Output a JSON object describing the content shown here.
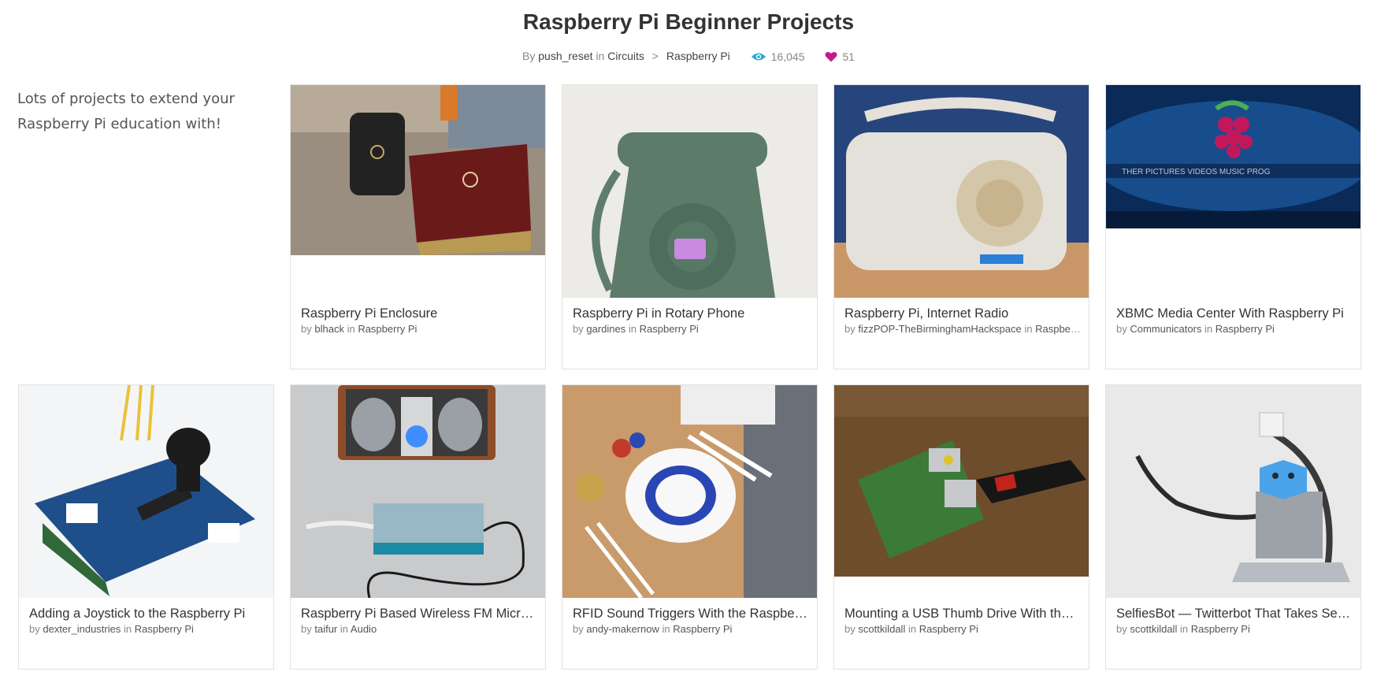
{
  "page": {
    "title": "Raspberry Pi Beginner Projects",
    "by_label": "By",
    "author": "push_reset",
    "in_label": "in",
    "category": "Circuits",
    "breadcrumb_sep": ">",
    "subcategory": "Raspberry Pi",
    "views": "16,045",
    "favorites": "51",
    "description": "Lots of projects to extend your Raspberry Pi education with!"
  },
  "colors": {
    "views_icon": "#29a8d6",
    "favorites_icon": "#c21a8a"
  },
  "cards": [
    {
      "title": "Raspberry Pi Enclosure",
      "by": "by",
      "author": "blhack",
      "in": "in",
      "category": "Raspberry Pi",
      "image": "enclosure"
    },
    {
      "title": "Raspberry Pi in Rotary Phone",
      "by": "by",
      "author": "gardines",
      "in": "in",
      "category": "Raspberry Pi",
      "image": "rotary-phone"
    },
    {
      "title": "Raspberry Pi, Internet Radio",
      "by": "by",
      "author": "fizzPOP-TheBirminghamHackspace",
      "in": "in",
      "category": "Raspberry Pi",
      "image": "radio"
    },
    {
      "title": "XBMC Media Center With Raspberry Pi",
      "by": "by",
      "author": "Communicators",
      "in": "in",
      "category": "Raspberry Pi",
      "image": "xbmc"
    },
    {
      "title": "Adding a Joystick to the Raspberry Pi",
      "by": "by",
      "author": "dexter_industries",
      "in": "in",
      "category": "Raspberry Pi",
      "image": "joystick"
    },
    {
      "title": "Raspberry Pi Based Wireless FM Microphone",
      "by": "by",
      "author": "taifur",
      "in": "in",
      "category": "Audio",
      "image": "fm-mic"
    },
    {
      "title": "RFID Sound Triggers With the Raspberry Pi",
      "by": "by",
      "author": "andy-makernow",
      "in": "in",
      "category": "Raspberry Pi",
      "image": "rfid"
    },
    {
      "title": "Mounting a USB Thumb Drive With the Raspberry Pi",
      "by": "by",
      "author": "scottkildall",
      "in": "in",
      "category": "Raspberry Pi",
      "image": "usb"
    },
    {
      "title": "SelfiesBot — Twitterbot That Takes Selfies",
      "by": "by",
      "author": "scottkildall",
      "in": "in",
      "category": "Raspberry Pi",
      "image": "selfiesbot"
    }
  ]
}
